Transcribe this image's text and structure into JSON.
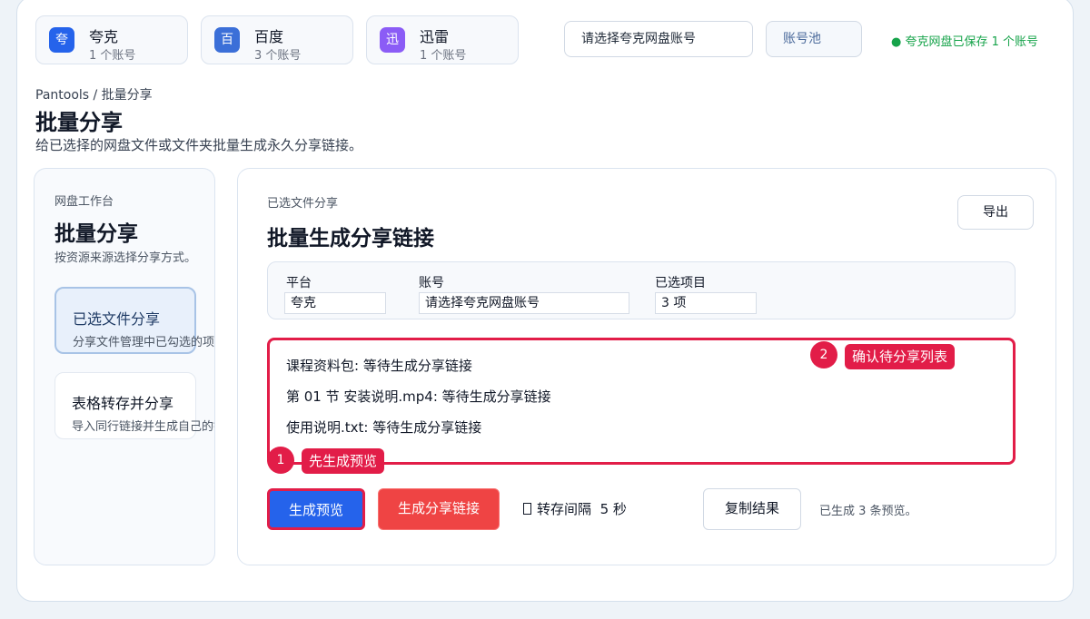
{
  "platforms": [
    {
      "icon": "夸",
      "name": "夸克",
      "count": "1 个账号",
      "color": "#2563eb"
    },
    {
      "icon": "百",
      "name": "百度",
      "count": "3 个账号",
      "color": "#3b6fd8"
    },
    {
      "icon": "迅",
      "name": "迅雷",
      "count": "1 个账号",
      "color": "#8b5cf6"
    }
  ],
  "account_select": "请选择夸克网盘账号",
  "pool_button": "账号池",
  "saved_status": "● 夸克网盘已保存 1 个账号",
  "breadcrumb": "Pantools / 批量分享",
  "page": {
    "title": "批量分享",
    "desc": "给已选择的网盘文件或文件夹批量生成永久分享链接。"
  },
  "sidebar": {
    "kicker": "网盘工作台",
    "title": "批量分享",
    "subtitle": "按资源来源选择分享方式。",
    "items": [
      {
        "label": "已选文件分享",
        "desc": "分享文件管理中已勾选的项目"
      },
      {
        "label": "表格转存并分享",
        "desc": "导入同行链接并生成自己的链"
      }
    ]
  },
  "main": {
    "kicker": "已选文件分享",
    "title": "批量生成分享链接",
    "export_button": "导出",
    "fields": {
      "platform_label": "平台",
      "platform_value": "夸克",
      "account_label": "账号",
      "account_value": "请选择夸克网盘账号",
      "selected_label": "已选项目",
      "selected_value": "3 项"
    },
    "preview_lines": [
      "课程资料包: 等待生成分享链接",
      "第 01 节 安装说明.mp4: 等待生成分享链接",
      "使用说明.txt: 等待生成分享链接"
    ],
    "generate_preview_button": "生成预览",
    "generate_links_button": "生成分享链接",
    "interval_text": "转存间隔",
    "interval_value": "5 秒",
    "copy_button": "复制结果",
    "result_text": "已生成 3 条预览。"
  },
  "callouts": [
    {
      "num": "1",
      "label": "先生成预览"
    },
    {
      "num": "2",
      "label": "确认待分享列表"
    }
  ]
}
